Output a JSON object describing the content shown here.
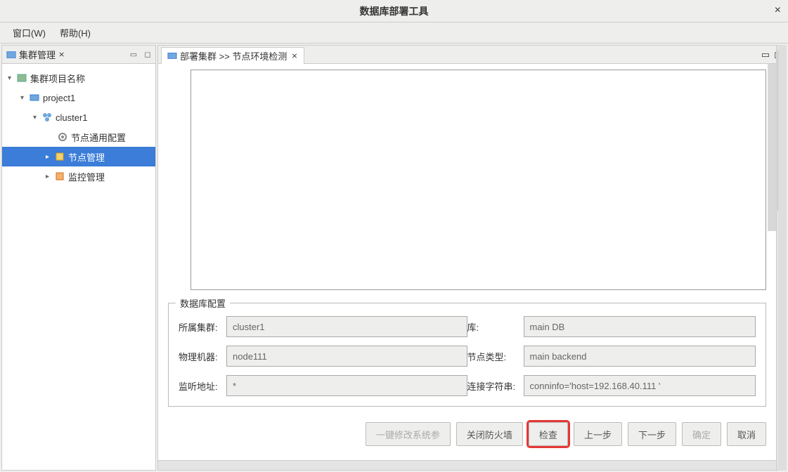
{
  "window": {
    "title": "数据库部署工具",
    "close": "×"
  },
  "menubar": {
    "window": "窗口(W)",
    "help": "帮助(H)"
  },
  "left_panel": {
    "title": "集群管理",
    "tab_close": "⨯"
  },
  "tree": {
    "root": "集群项目名称",
    "project": "project1",
    "cluster": "cluster1",
    "node_config": "节点通用配置",
    "node_mgmt": "节点管理",
    "monitor_mgmt": "监控管理"
  },
  "right_panel": {
    "breadcrumb": "部署集群 >> 节点环境检测",
    "tab_close": "⨯"
  },
  "fieldset": {
    "legend": "数据库配置",
    "labels": {
      "cluster": "所属集群:",
      "db": "库:",
      "machine": "物理机器:",
      "node_type": "节点类型:",
      "listen_addr": "监听地址:",
      "conn_str": "连接字符串:"
    },
    "values": {
      "cluster": "cluster1",
      "db": "main DB",
      "machine": "node111",
      "node_type": "main backend",
      "listen_addr": "*",
      "conn_str": "conninfo='host=192.168.40.111 '"
    }
  },
  "buttons": {
    "modify_params": "一键修改系统参",
    "close_firewall": "关闭防火墙",
    "check": "检查",
    "prev": "上一步",
    "next": "下一步",
    "ok": "确定",
    "cancel": "取消"
  }
}
